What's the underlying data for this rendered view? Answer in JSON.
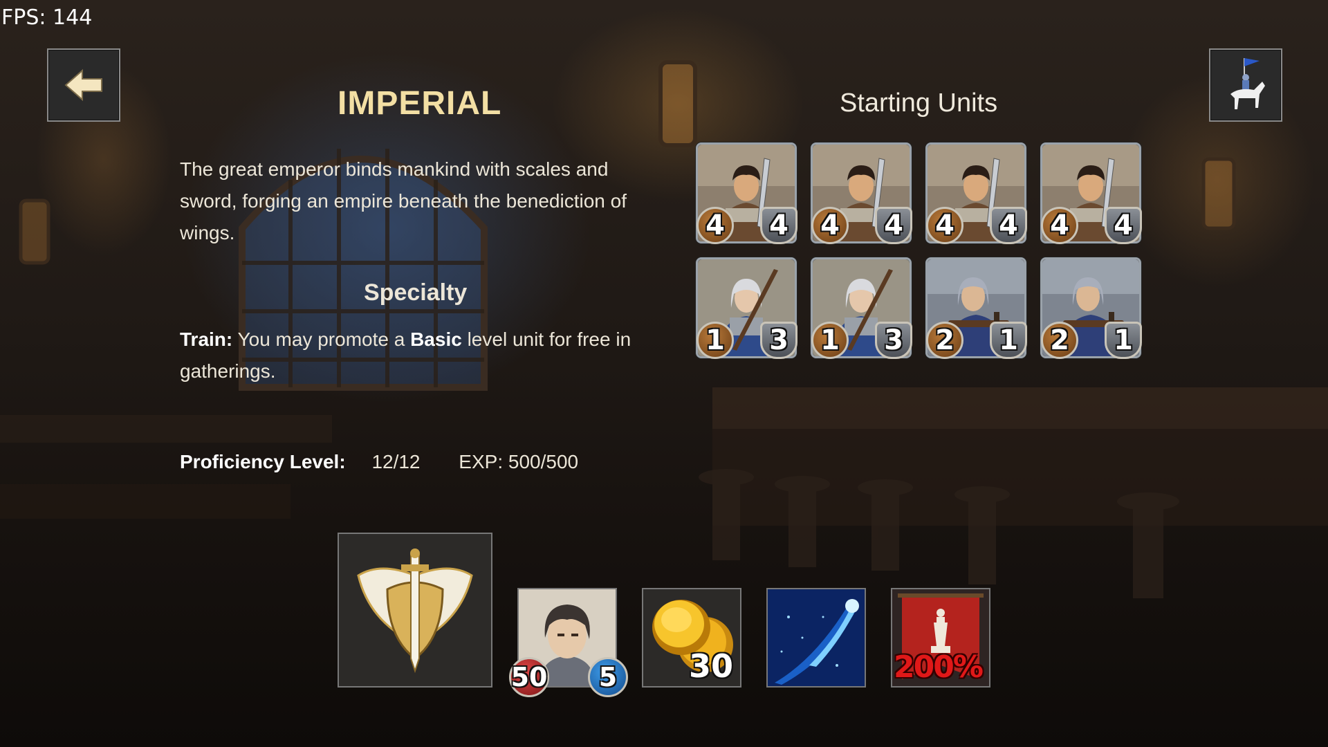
{
  "hud": {
    "fps": "FPS: 144"
  },
  "faction": {
    "name": "IMPERIAL",
    "description": "The great emperor binds mankind with scales and sword, forging an empire beneath the benediction of wings.",
    "specialty_title": "Specialty",
    "specialty": {
      "label": "Train:",
      "text_before": "You may promote a",
      "highlight": "Basic",
      "text_after": "level unit for free in gatherings."
    },
    "proficiency": {
      "label": "Proficiency Level:",
      "level": "12/12",
      "exp": "EXP: 500/500"
    }
  },
  "starting_units": {
    "title": "Starting Units",
    "units": [
      {
        "type": "swordsman",
        "left": "4",
        "right": "4"
      },
      {
        "type": "swordsman",
        "left": "4",
        "right": "4"
      },
      {
        "type": "swordsman",
        "left": "4",
        "right": "4"
      },
      {
        "type": "swordsman",
        "left": "4",
        "right": "4"
      },
      {
        "type": "spearwoman",
        "left": "1",
        "right": "3"
      },
      {
        "type": "spearwoman",
        "left": "1",
        "right": "3"
      },
      {
        "type": "crossbowman",
        "left": "2",
        "right": "1"
      },
      {
        "type": "crossbowman",
        "left": "2",
        "right": "1"
      }
    ]
  },
  "bottom": {
    "emblem_icon": "winged-sword-emblem-icon",
    "hero": {
      "hp": "50",
      "level": "5"
    },
    "gold": "30",
    "spell_icon": "blue-comet-icon",
    "banner": "200%"
  },
  "buttons": {
    "back_icon": "arrow-left-icon",
    "unit_icon": "knight-on-horse-icon"
  },
  "colors": {
    "title": "#f3dfa4",
    "badge_red": "#e04848",
    "badge_blue": "#3d9be8",
    "percent_red": "#e01818"
  }
}
